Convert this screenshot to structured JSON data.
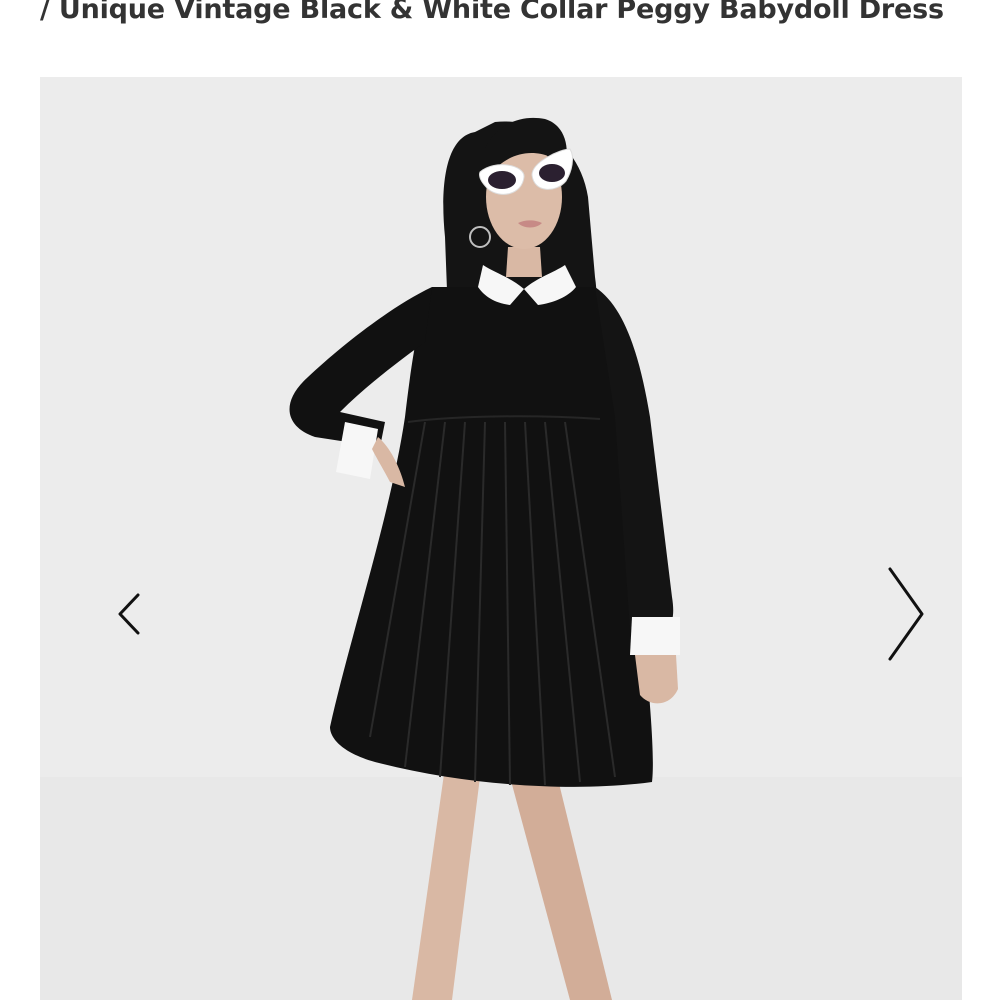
{
  "product": {
    "title": "/ Unique Vintage Black & White Collar Peggy Babydoll Dress"
  },
  "gallery": {
    "prev_icon": "chevron-left-icon",
    "next_icon": "chevron-right-icon",
    "image_subject": "model wearing black babydoll dress with white collar and cuffs",
    "colors": {
      "background": "#ececec",
      "dress": "#111111",
      "collar": "#f7f7f7",
      "arrow": "#111111"
    }
  }
}
